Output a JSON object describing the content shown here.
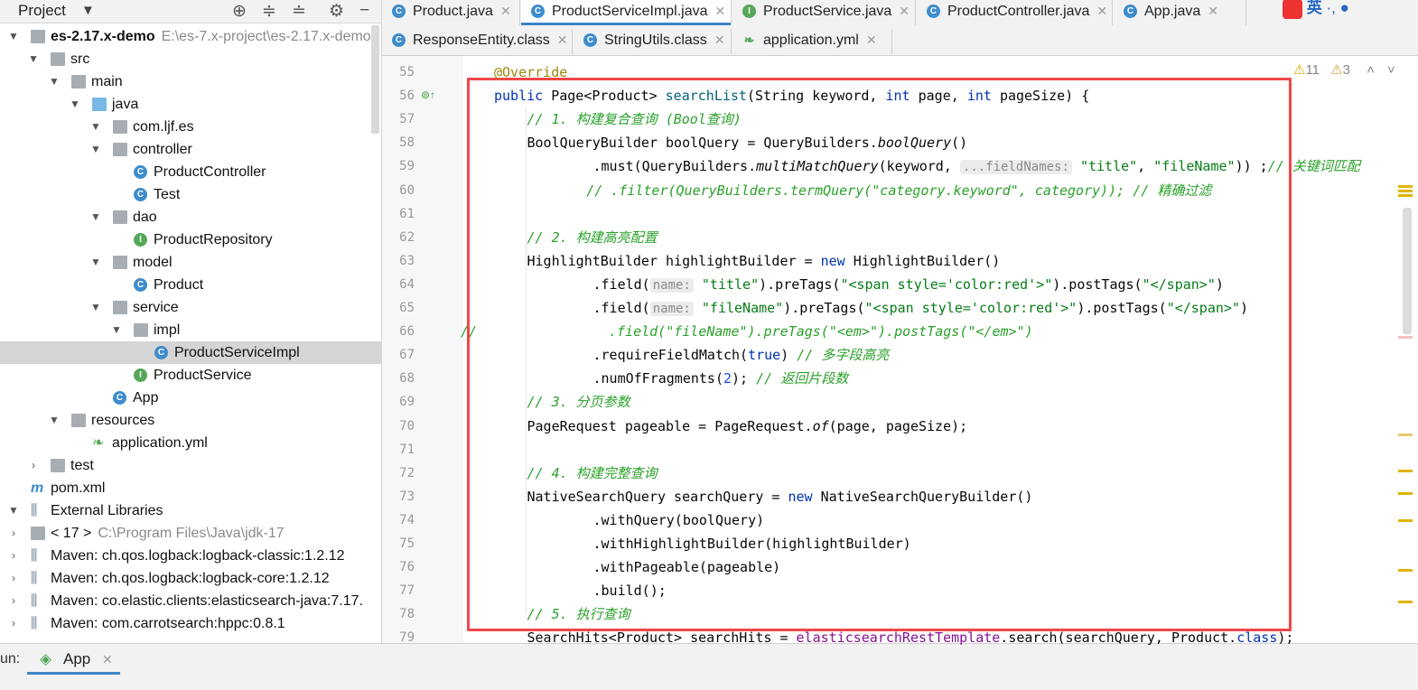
{
  "project": {
    "title": "Project",
    "tree": [
      {
        "label": "es-2.17.x-demo",
        "extra": "E:\\es-7.x-project\\es-2.17.x-demo",
        "icon": "module-folder-icon",
        "bold": true
      },
      {
        "label": "src",
        "icon": "folder-icon"
      },
      {
        "label": "main",
        "icon": "folder-icon"
      },
      {
        "label": "java",
        "icon": "source-folder-icon"
      },
      {
        "label": "com.ljf.es",
        "icon": "package-icon"
      },
      {
        "label": "controller",
        "icon": "package-icon"
      },
      {
        "label": "ProductController",
        "icon": "class-icon"
      },
      {
        "label": "Test",
        "icon": "class-icon"
      },
      {
        "label": "dao",
        "icon": "package-icon"
      },
      {
        "label": "ProductRepository",
        "icon": "interface-icon"
      },
      {
        "label": "model",
        "icon": "package-icon"
      },
      {
        "label": "Product",
        "icon": "class-icon"
      },
      {
        "label": "service",
        "icon": "package-icon"
      },
      {
        "label": "impl",
        "icon": "package-icon"
      },
      {
        "label": "ProductServiceImpl",
        "icon": "class-icon",
        "selected": true
      },
      {
        "label": "ProductService",
        "icon": "interface-icon"
      },
      {
        "label": "App",
        "icon": "class-icon"
      },
      {
        "label": "resources",
        "icon": "resources-folder-icon"
      },
      {
        "label": "application.yml",
        "icon": "yaml-icon"
      },
      {
        "label": "test",
        "icon": "folder-icon"
      },
      {
        "label": "pom.xml",
        "icon": "maven-icon"
      },
      {
        "label": "External Libraries",
        "icon": "library-icon"
      },
      {
        "label": "< 17 >",
        "extra": "C:\\Program Files\\Java\\jdk-17",
        "icon": "jdk-icon"
      },
      {
        "label": "Maven: ch.qos.logback:logback-classic:1.2.12",
        "icon": "jar-icon"
      },
      {
        "label": "Maven: ch.qos.logback:logback-core:1.2.12",
        "icon": "jar-icon"
      },
      {
        "label": "Maven: co.elastic.clients:elasticsearch-java:7.17.",
        "icon": "jar-icon"
      },
      {
        "label": "Maven: com.carrotsearch:hppc:0.8.1",
        "icon": "jar-icon"
      }
    ]
  },
  "tabs_row1": [
    {
      "label": "Product.java",
      "icon": "C",
      "active": false
    },
    {
      "label": "ProductServiceImpl.java",
      "icon": "C",
      "active": true
    },
    {
      "label": "ProductService.java",
      "icon": "I",
      "active": false
    },
    {
      "label": "ProductController.java",
      "icon": "C",
      "active": false
    },
    {
      "label": "App.java",
      "icon": "C",
      "active": false
    }
  ],
  "tabs_row2": [
    {
      "label": "ResponseEntity.class",
      "icon": "C"
    },
    {
      "label": "StringUtils.class",
      "icon": "C"
    },
    {
      "label": "application.yml",
      "icon": "Y"
    }
  ],
  "inspections": {
    "warnings": "11",
    "weak_warnings": "3"
  },
  "line_numbers": [
    "55",
    "56",
    "57",
    "58",
    "59",
    "60",
    "61",
    "62",
    "63",
    "64",
    "65",
    "66",
    "67",
    "68",
    "69",
    "70",
    "71",
    "72",
    "73",
    "74",
    "75",
    "76",
    "77",
    "78",
    "79"
  ],
  "code": {
    "l55": "@Override",
    "l56a": "public ",
    "l56b": "Page<Product> ",
    "l56c": "searchList",
    "l56d": "(String keyword, ",
    "l56e": "int ",
    "l56f": "page, ",
    "l56g": "int ",
    "l56h": "pageSize) {",
    "l57": "// 1. 构建复合查询 (Bool查询)",
    "l58a": "BoolQueryBuilder boolQuery = QueryBuilders.",
    "l58b": "boolQuery",
    "l58c": "()",
    "l59a": ".must(QueryBuilders.",
    "l59b": "multiMatchQuery",
    "l59c": "(keyword, ",
    "l59d": "...fieldNames:",
    "l59e": " \"title\"",
    "l59f": ", ",
    "l59g": "\"fileName\"",
    "l59h": ")) ;",
    "l59i": "// 关键词匹配",
    "l60": "// .filter(QueryBuilders.termQuery(\"category.keyword\", category)); // 精确过滤",
    "l62": "// 2. 构建高亮配置",
    "l63a": "HighlightBuilder highlightBuilder = ",
    "l63b": "new ",
    "l63c": "HighlightBuilder()",
    "l64a": ".field(",
    "l64b": "name:",
    "l64c": " \"title\"",
    "l64d": ").preTags(",
    "l64e": "\"<span style='color:red'>\"",
    "l64f": ").postTags(",
    "l64g": "\"</span>\"",
    "l64h": ")",
    "l65a": ".field(",
    "l65b": "name:",
    "l65c": " \"fileName\"",
    "l65d": ").preTags(",
    "l65e": "\"<span style='color:red'>\"",
    "l65f": ").postTags(",
    "l65g": "\"</span>\"",
    "l65h": ")",
    "l66a": "//",
    "l66b": ".field(\"fileName\").preTags(\"<em>\").postTags(\"</em>\")",
    "l67a": ".requireFieldMatch(",
    "l67b": "true",
    "l67c": ") ",
    "l67d": "// 多字段高亮",
    "l68a": ".numOfFragments(",
    "l68b": "2",
    "l68c": "); ",
    "l68d": "// 返回片段数",
    "l69": "// 3. 分页参数",
    "l70a": "PageRequest pageable = PageRequest.",
    "l70b": "of",
    "l70c": "(page, pageSize);",
    "l72": "// 4. 构建完整查询",
    "l73a": "NativeSearchQuery searchQuery = ",
    "l73b": "new ",
    "l73c": "NativeSearchQueryBuilder()",
    "l74": ".withQuery(boolQuery)",
    "l75": ".withHighlightBuilder(highlightBuilder)",
    "l76": ".withPageable(pageable)",
    "l77": ".build();",
    "l78": "// 5. 执行查询",
    "l79a": "SearchHits<Product> searchHits = ",
    "l79b": "elasticsearchRestTemplate",
    "l79c": ".search(searchQuery, Product.",
    "l79d": "class",
    "l79e": ");"
  },
  "bottom": {
    "run_label": "un:",
    "run_tab": "App"
  },
  "tray": {
    "ime": "英"
  }
}
